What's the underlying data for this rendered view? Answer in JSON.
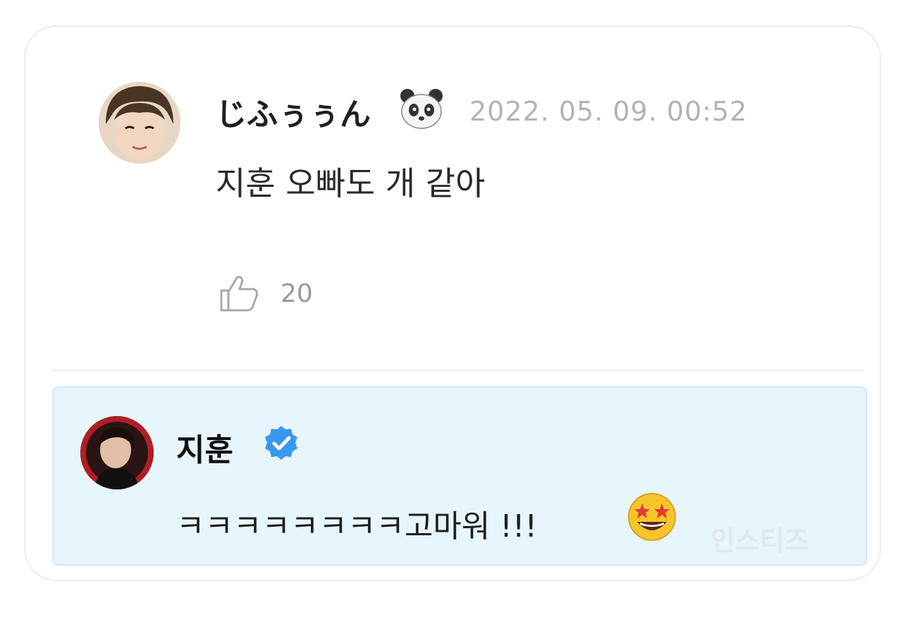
{
  "comment": {
    "username": "じふぅぅん",
    "username_emoji_icon": "panda-face-icon",
    "timestamp": "2022. 05. 09. 00:52",
    "text": "지훈 오빠도 개 같아",
    "like_icon": "thumbs-up-outline-icon",
    "like_count": "20"
  },
  "reply": {
    "name": "지훈",
    "verified_icon": "verified-badge-icon",
    "text": "ㅋㅋㅋㅋㅋㅋㅋㅋ고마워 !!!",
    "trailing_emoji_icon": "star-struck-face-icon",
    "watermark": "인스티즈"
  },
  "colors": {
    "reply_background": "#e7f5fd",
    "verified_blue": "#3897f0",
    "timestamp_gray": "#b3b3b3"
  }
}
